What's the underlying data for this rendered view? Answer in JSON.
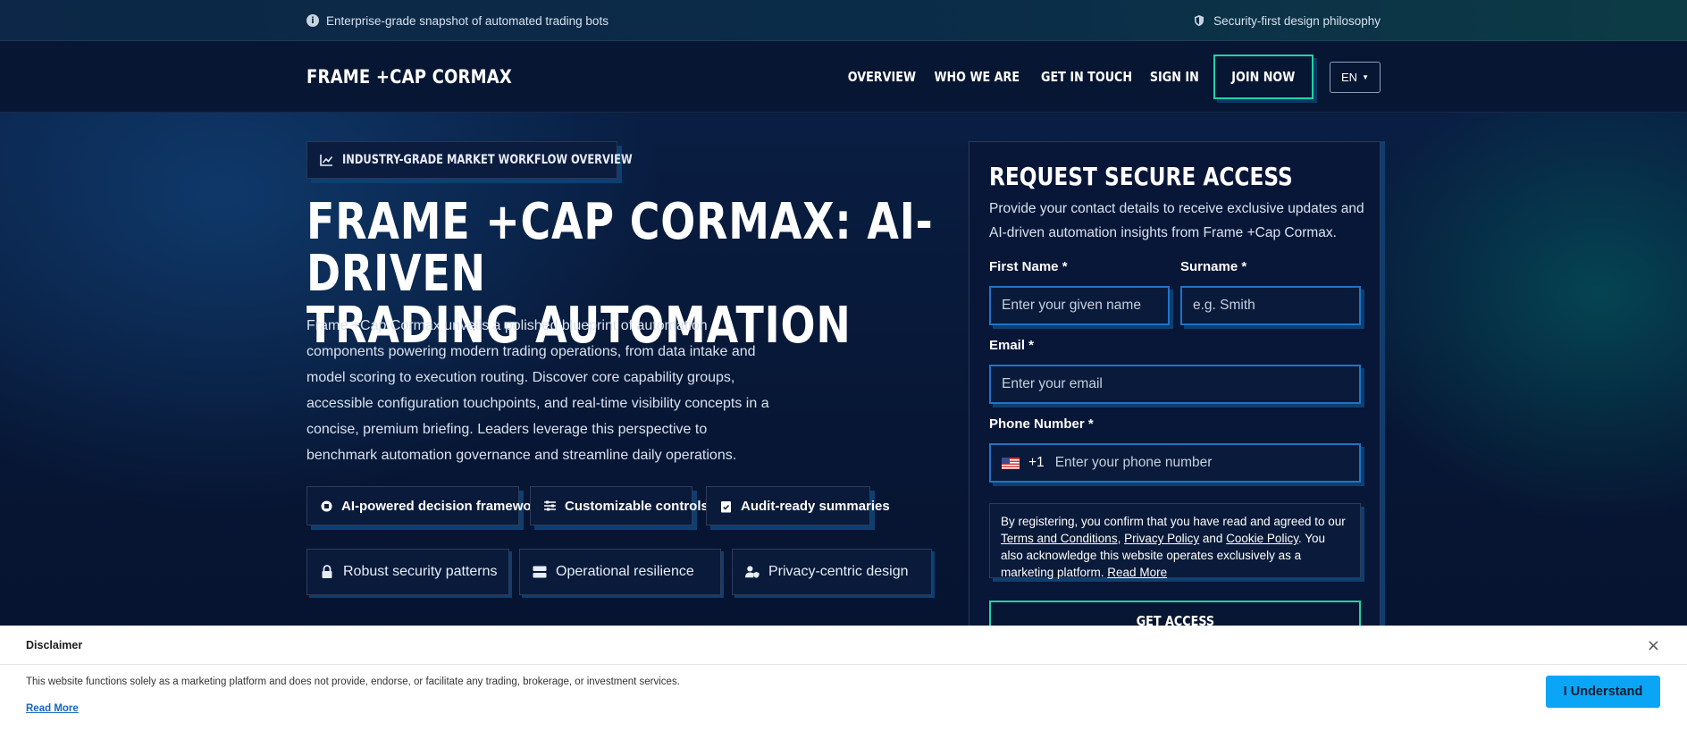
{
  "topbar": {
    "left_text": "Enterprise-grade snapshot of automated trading bots",
    "right_text": "Security-first design philosophy"
  },
  "header": {
    "logo": "FRAME +CAP CORMAX",
    "nav": [
      "OVERVIEW",
      "WHO WE ARE",
      "GET IN TOUCH",
      "SIGN IN"
    ],
    "join_label": "JOIN NOW",
    "language": "EN"
  },
  "hero": {
    "badge": "INDUSTRY-GRADE MARKET WORKFLOW OVERVIEW",
    "title_line1": "FRAME +CAP CORMAX: AI-DRIVEN",
    "title_line2": "TRADING AUTOMATION",
    "description": "Frame +Cap Cormax unveils a polished blueprint of automation components powering modern trading operations, from data intake and model scoring to execution routing. Discover core capability groups, accessible configuration touchpoints, and real-time visibility concepts in a concise, premium briefing. Leaders leverage this perspective to benchmark automation governance and streamline daily operations.",
    "chips": [
      "AI-powered decision framework",
      "Customizable controls",
      "Audit-ready summaries"
    ],
    "features": [
      "Robust security patterns",
      "Operational resilience",
      "Privacy-centric design"
    ]
  },
  "form": {
    "title": "REQUEST SECURE ACCESS",
    "subtitle": "Provide your contact details to receive exclusive updates and AI-driven automation insights from Frame +Cap Cormax.",
    "first_name_label": "First Name *",
    "first_name_placeholder": "Enter your given name",
    "surname_label": "Surname *",
    "surname_placeholder": "e.g. Smith",
    "email_label": "Email *",
    "email_placeholder": "Enter your email",
    "phone_label": "Phone Number *",
    "phone_code": "+1",
    "phone_placeholder": "Enter your phone number",
    "terms": {
      "prefix": "By registering, you confirm that you have read and agreed to our ",
      "terms_link": "Terms and Conditions",
      "comma": ", ",
      "privacy_link": "Privacy Policy",
      "and": " and ",
      "cookie_link": "Cookie Policy",
      "suffix": ". You also acknowledge this website operates exclusively as a marketing platform. ",
      "read_more": "Read More"
    },
    "submit_label": "GET ACCESS"
  },
  "disclaimer": {
    "title": "Disclaimer",
    "text": "This website functions solely as a marketing platform and does not provide, endorse, or facilitate any trading, brokerage, or investment services.",
    "read_more": "Read More",
    "button": "I Understand",
    "close": "×"
  },
  "colors": {
    "accent_teal": "#22d3a6",
    "accent_blue": "#1e74c7",
    "shadow_blue": "#0d3f70",
    "button_blue": "#0aa6f5",
    "background": "#061330"
  }
}
